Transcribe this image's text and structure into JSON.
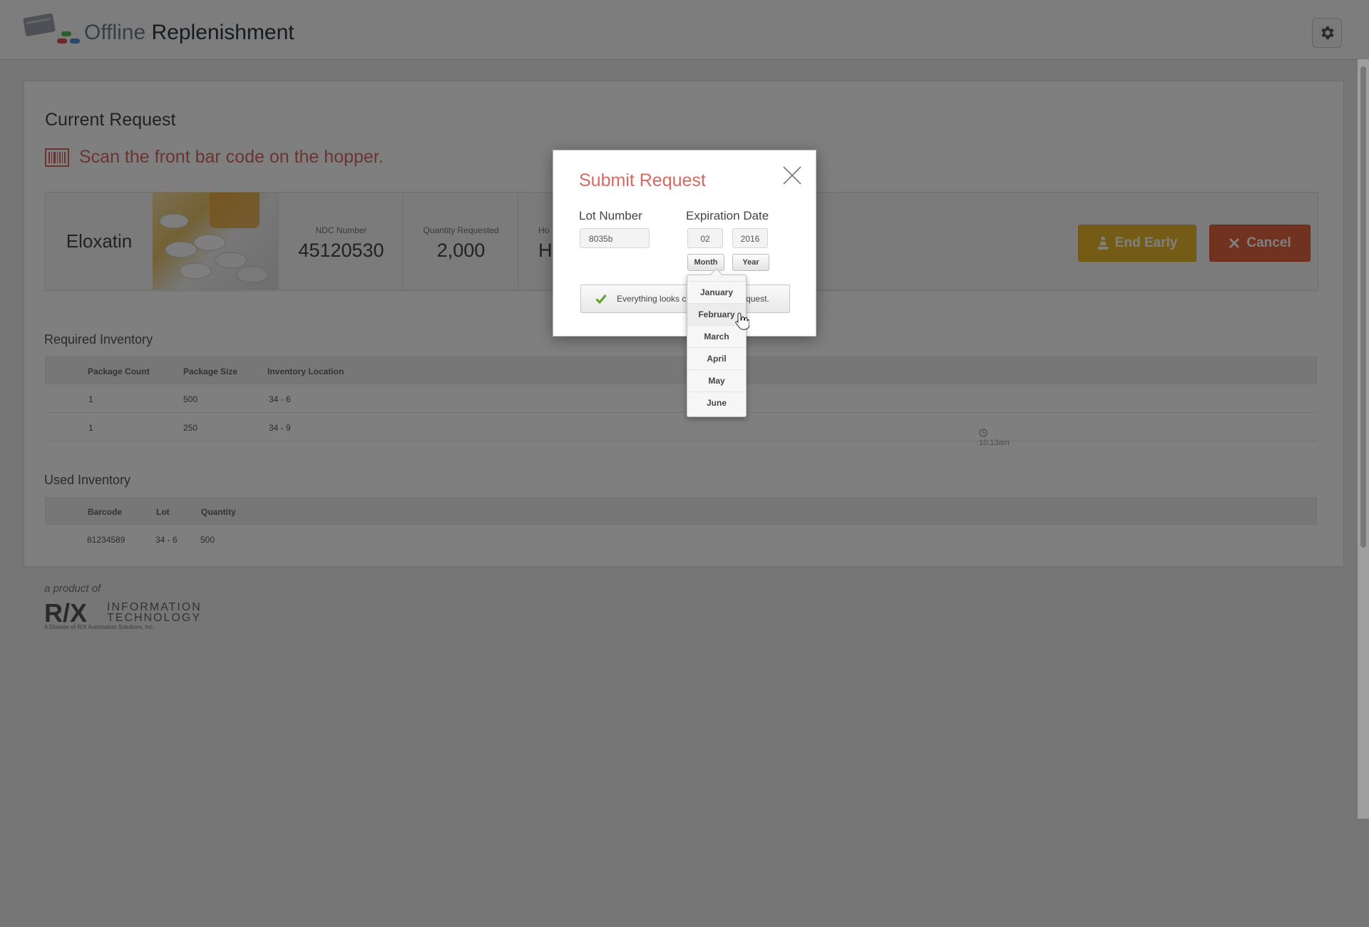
{
  "header": {
    "title_part1": "Offline",
    "title_part2": " Replenishment"
  },
  "main": {
    "title": "Current Request",
    "instruction": "Scan the front bar code on the hopper.",
    "drug": {
      "name": "Eloxatin",
      "ndc_label": "NDC Number",
      "ndc_value": "45120530",
      "qty_label": "Quantity Requested",
      "qty_value": "2,000",
      "hopper_label": "Ho",
      "hopper_value": "H"
    },
    "buttons": {
      "end_early": "End Early",
      "cancel": "Cancel"
    }
  },
  "required_inventory": {
    "title": "Required Inventory",
    "columns": [
      "Package Count",
      "Package Size",
      "Inventory Location"
    ],
    "rows": [
      {
        "count": "1",
        "size": "500",
        "location": "34 - 6"
      },
      {
        "count": "1",
        "size": "250",
        "location": "34 - 9"
      }
    ],
    "timestamp": "10.13am"
  },
  "used_inventory": {
    "title": "Used Inventory",
    "columns": [
      "Barcode",
      "Lot",
      "Quantity"
    ],
    "rows": [
      {
        "barcode": "81234589",
        "lot": "34 - 6",
        "quantity": "500"
      }
    ]
  },
  "footer": {
    "tagline": "a product of",
    "logo_text": "R/X INFORMATION TECHNOLOGY",
    "logo_sub": "A Division of R/X Automation Solutions, Inc."
  },
  "modal": {
    "title": "Submit Request",
    "lot_label": "Lot Number",
    "lot_value": "8035b",
    "exp_label": "Expiration Date",
    "month_value": "02",
    "year_value": "2016",
    "month_button": "Month",
    "year_button": "Year",
    "status_left": "Everything looks c",
    "status_right": "equest."
  },
  "month_dropdown": {
    "options": [
      "January",
      "February",
      "March",
      "April",
      "May",
      "June"
    ],
    "hovered": "February"
  },
  "colors": {
    "accent_red": "#d56a63",
    "end_early_yellow": "#e8b82f",
    "cancel_orange": "#e2643f",
    "check_green": "#5ba02b"
  }
}
